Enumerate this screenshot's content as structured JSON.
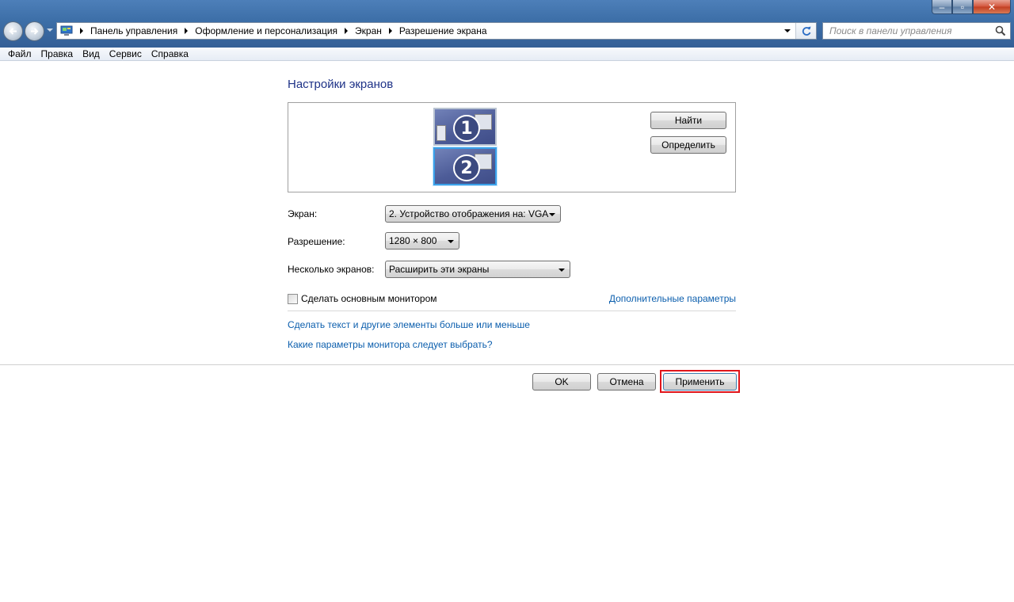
{
  "window": {
    "caption_buttons": {
      "minimize": "‒",
      "maximize": "▫",
      "close": "✕"
    }
  },
  "address_bar": {
    "crumbs": [
      "Панель управления",
      "Оформление и персонализация",
      "Экран",
      "Разрешение экрана"
    ]
  },
  "search": {
    "placeholder": "Поиск в панели управления"
  },
  "menu": [
    "Файл",
    "Правка",
    "Вид",
    "Сервис",
    "Справка"
  ],
  "content": {
    "heading": "Настройки экранов",
    "monitors": [
      {
        "number": "1",
        "selected": false
      },
      {
        "number": "2",
        "selected": true
      }
    ],
    "find_button": "Найти",
    "identify_button": "Определить",
    "display_label": "Экран:",
    "display_value": "2. Устройство отображения на: VGA",
    "resolution_label": "Разрешение:",
    "resolution_value": "1280 × 800",
    "multiple_label": "Несколько экранов:",
    "multiple_value": "Расширить эти экраны",
    "make_main_label": "Сделать основным монитором",
    "make_main_checked": false,
    "advanced_link": "Дополнительные параметры",
    "text_size_link": "Сделать текст и другие элементы больше или меньше",
    "which_settings_link": "Какие параметры монитора следует выбрать?"
  },
  "footer": {
    "ok": "OK",
    "cancel": "Отмена",
    "apply": "Применить"
  },
  "colors": {
    "heading": "#1e3287",
    "link": "#0b5ead",
    "highlight": "#e0151b"
  }
}
